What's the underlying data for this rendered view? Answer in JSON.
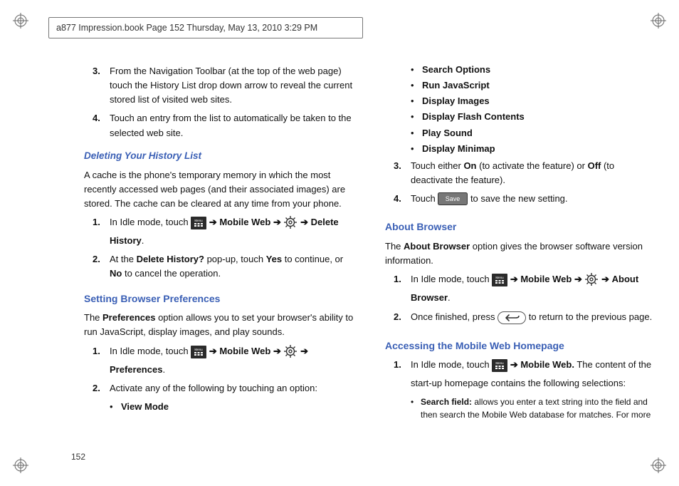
{
  "header_line": "a877 Impression.book  Page 152  Thursday, May 13, 2010  3:29 PM",
  "page_number": "152",
  "arrow_glyph": "➔",
  "left": {
    "items_top": [
      {
        "n": "3.",
        "t": "From the Navigation Toolbar (at the top of the web page) touch the History List drop down arrow to reveal the current stored list of visited web sites."
      },
      {
        "n": "4.",
        "t": "Touch an entry from the list to automatically be taken to the selected web site."
      }
    ],
    "h_delete": "Deleting Your History List",
    "p_cache": "A cache is the phone's temporary memory in which the most recently accessed web pages (and their associated images) are stored. The cache can be cleared at any time from your phone.",
    "del_step1_a": "In Idle mode, touch ",
    "del_step1_b": " Mobile Web ",
    "del_step1_c": "Delete History",
    "del_step2_a": "At the ",
    "del_step2_b": "Delete History?",
    "del_step2_c": " pop-up, touch ",
    "del_step2_yes": "Yes",
    "del_step2_d": " to continue, or ",
    "del_step2_no": "No",
    "del_step2_e": " to cancel the operation.",
    "h_prefs": "Setting Browser Preferences",
    "p_prefs_a": "The ",
    "p_prefs_b": "Preferences",
    "p_prefs_c": " option allows you to set your browser's ability to run JavaScript, display images, and play sounds.",
    "pref_step1_a": "In Idle mode, touch ",
    "pref_step1_b": " Mobile Web ",
    "pref_step1_c": "Preferences",
    "pref_step2": "Activate any of the following by touching an option:",
    "pref_bullets_first": "View Mode"
  },
  "right": {
    "bullets": [
      "Search Options",
      "Run JavaScript",
      "Display Images",
      "Display Flash Contents",
      "Play Sound",
      "Display Minimap"
    ],
    "step3_a": "Touch either ",
    "step3_on": "On",
    "step3_b": " (to activate the feature) or ",
    "step3_off": "Off",
    "step3_c": " (to deactivate the feature).",
    "step4_a": "Touch ",
    "step4_b": " to save the new setting.",
    "save_label": "Save",
    "h_about": "About Browser",
    "p_about_a": "The ",
    "p_about_b": "About Browser",
    "p_about_c": " option gives the browser software version information.",
    "about_step1_a": "In Idle mode, touch ",
    "about_step1_b": " Mobile Web ",
    "about_step1_c": " About Browser",
    "about_step2_a": "Once finished, press ",
    "about_step2_b": " to return to the previous page.",
    "h_home": "Accessing the Mobile Web Homepage",
    "home_step1_a": "In Idle mode, touch ",
    "home_step1_b": " Mobile Web.",
    "home_step1_c": " The content of the start-up homepage contains the following selections:",
    "home_sub_b": "Search field:",
    "home_sub_t": " allows you enter a text string into the field and then search the Mobile Web database for matches. For more"
  }
}
